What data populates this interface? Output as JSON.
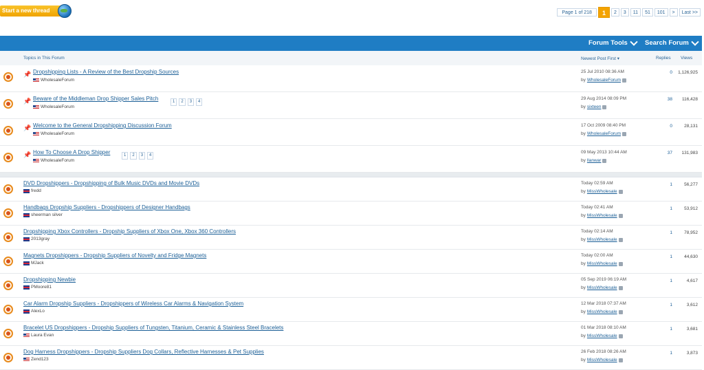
{
  "top": {
    "start_thread": "Start a new thread",
    "pager": {
      "info": "Page 1 of 218",
      "current": "1",
      "pages": [
        "2",
        "3",
        "11",
        "51",
        "101"
      ],
      "next": ">",
      "last": "Last >>"
    }
  },
  "toolbar": {
    "forum_tools": "Forum Tools",
    "search_forum": "Search Forum"
  },
  "columns": {
    "topics": "Topics in This Forum",
    "newest": "Newest Post First",
    "replies": "Replies",
    "views": "Views"
  },
  "sticky": [
    {
      "title": "Dropshipping Lists - A Review of the Best Dropship Sources",
      "author": "WholesaleForum",
      "date": "25 Jul 2010 08:36 AM",
      "by": "WholesaleForum",
      "replies": "0",
      "views": "1,126,925",
      "pages": []
    },
    {
      "title": "Beware of the Middleman Drop Shipper Sales Pitch",
      "author": "WholesaleForum",
      "date": "29 Aug 2014 08:09 PM",
      "by": "sixteen",
      "replies": "38",
      "views": "116,428",
      "pages": [
        "1",
        "2",
        "3",
        "4"
      ]
    },
    {
      "title": "Welcome to the General Dropshipping Discussion Forum",
      "author": "WholesaleForum",
      "date": "17 Oct 2009 08:40 PM",
      "by": "WholesaleForum",
      "replies": "0",
      "views": "28,131",
      "pages": []
    },
    {
      "title": "How To Choose A Drop Shipper",
      "author": "WholesaleForum",
      "date": "09 May 2013 10:44 AM",
      "by": "llanwar",
      "replies": "37",
      "views": "131,983",
      "pages": [
        "1",
        "2",
        "3",
        "4"
      ]
    }
  ],
  "threads": [
    {
      "title": "DVD Dropshippers - Dropshipping of Bulk Music DVDs and Movie DVDs",
      "author": "fredd",
      "date": "Today 02:59 AM",
      "by": "MissWholesale",
      "replies": "1",
      "views": "56,277"
    },
    {
      "title": "Handbags Dropship Suppliers - Dropshippers of Designer Handbags",
      "author": "sheerman silver",
      "date": "Today 02:41 AM",
      "by": "MissWholesale",
      "replies": "1",
      "views": "53,912"
    },
    {
      "title": "Dropshipping Xbox Controllers - Dropship Suppliers of Xbox One, Xbox 360 Controllers",
      "author": "2013gray",
      "date": "Today 02:14 AM",
      "by": "MissWholesale",
      "replies": "1",
      "views": "78,952"
    },
    {
      "title": "Magnets Dropshippers - Dropship Suppliers of Novelty and Fridge Magnets",
      "author": "MJack",
      "date": "Today 02:00 AM",
      "by": "MissWholesale",
      "replies": "1",
      "views": "44,630"
    },
    {
      "title": "Dropshipping Newbie",
      "author": "PMoore81",
      "date": "05 Sep 2019 06:19 AM",
      "by": "MissWholesale",
      "replies": "1",
      "views": "4,617"
    },
    {
      "title": "Car Alarm Dropship Suppliers - Dropshippers of Wireless Car Alarms & Navigation System",
      "author": "AlexLo",
      "date": "12 Mar 2018 07:37 AM",
      "by": "MissWholesale",
      "replies": "1",
      "views": "3,612"
    },
    {
      "title": "Bracelet US Dropshippers - Dropship Suppliers of Tungsten, Titanium, Ceramic & Stainless Steel Bracelets",
      "author": "Laura Evan",
      "date": "01 Mar 2018 08:10 AM",
      "by": "MissWholesale",
      "replies": "1",
      "views": "3,681"
    },
    {
      "title": "Dog Harness Dropshippers - Dropship Suppliers Dog Collars, Reflective Harnesses & Pet Supplies",
      "author": "Zend123",
      "date": "26 Feb 2018 08:26 AM",
      "by": "MissWholesale",
      "replies": "1",
      "views": "3,873"
    }
  ]
}
